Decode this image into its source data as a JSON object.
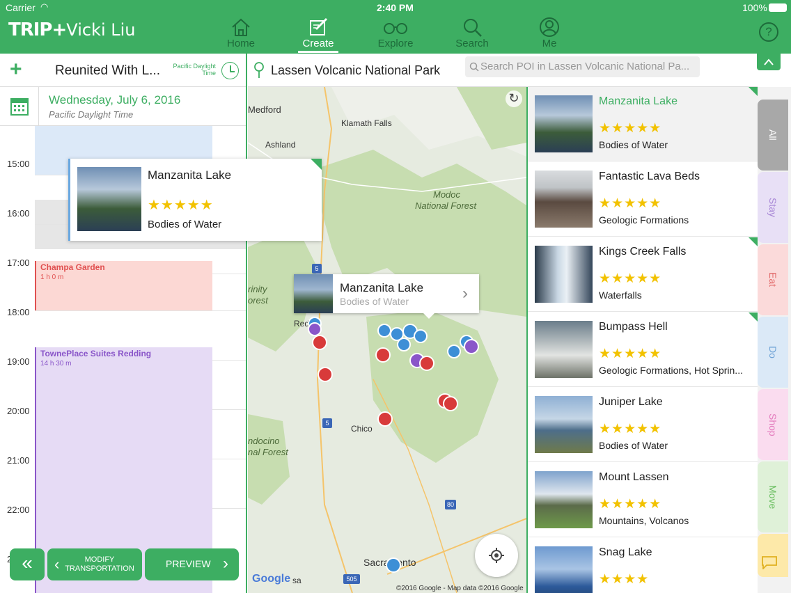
{
  "status": {
    "carrier": "Carrier",
    "time": "2:40 PM",
    "battery": "100%"
  },
  "app": {
    "logo": "TRIP",
    "plus": "+",
    "user": "Vicki Liu"
  },
  "nav": [
    {
      "label": "Home",
      "icon": "home-icon"
    },
    {
      "label": "Create",
      "icon": "create-icon"
    },
    {
      "label": "Explore",
      "icon": "binoculars-icon"
    },
    {
      "label": "Search",
      "icon": "search-icon"
    },
    {
      "label": "Me",
      "icon": "profile-icon"
    }
  ],
  "help_icon": "help-icon",
  "trip": {
    "title": "Reunited With L...",
    "tz_line1": "Pacific Daylight",
    "tz_line2": "Time"
  },
  "day": {
    "date": "Wednesday, July 6, 2016",
    "tz": "Pacific Daylight Time"
  },
  "hours": [
    "15:00",
    "16:00",
    "17:00",
    "18:00",
    "19:00",
    "20:00",
    "21:00",
    "22:00",
    "2"
  ],
  "events": [
    {
      "title": "Champa Garden",
      "duration": "1 h 0 m",
      "color": "#e05050"
    },
    {
      "title": "TownePlace Suites Redding",
      "duration": "14 h 30 m",
      "color": "#8a56c9"
    }
  ],
  "drag_card": {
    "name": "Manzanita Lake",
    "stars": "★★★★★",
    "category": "Bodies of Water"
  },
  "buttons": {
    "back": "«",
    "modify_line1": "MODIFY",
    "modify_line2": "TRANSPORTATION",
    "preview": "PREVIEW"
  },
  "park": {
    "name": "Lassen Volcanic National Park",
    "search_placeholder": "Search POI in Lassen Volcanic National Pa..."
  },
  "map": {
    "labels": [
      "Medford",
      "Klamath Falls",
      "Ashland",
      "Modoc",
      "National Forest",
      "rinity",
      "orest",
      "Red",
      "Chico",
      "ndocino",
      "nal Forest",
      "Sacramento",
      "sa"
    ],
    "shields": [
      "5",
      "5",
      "80",
      "505"
    ],
    "callout": {
      "name": "Manzanita Lake",
      "category": "Bodies of Water"
    },
    "logo": "Google",
    "attribution": "©2016 Google - Map data ©2016 Google"
  },
  "pois": [
    {
      "name": "Manzanita Lake",
      "rating": "★★★★★",
      "category": "Bodies of Water",
      "selected": true
    },
    {
      "name": "Fantastic Lava Beds",
      "rating": "★★★★★",
      "category": "Geologic Formations"
    },
    {
      "name": "Kings Creek Falls",
      "rating": "★★★★★",
      "category": "Waterfalls"
    },
    {
      "name": "Bumpass Hell",
      "rating": "★★★★★",
      "category": "Geologic Formations, Hot Sprin..."
    },
    {
      "name": "Juniper Lake",
      "rating": "★★★★★",
      "category": "Bodies of Water"
    },
    {
      "name": "Mount Lassen",
      "rating": "★★★★★",
      "category": "Mountains, Volcanos"
    },
    {
      "name": "Snag Lake",
      "rating": "★★★★",
      "category": ""
    }
  ],
  "tabs": [
    {
      "label": "All",
      "bg": "#a8a8a8",
      "fg": "#ffffff"
    },
    {
      "label": "Stay",
      "bg": "#e8e0f6",
      "fg": "#a887d6"
    },
    {
      "label": "Eat",
      "bg": "#fbdada",
      "fg": "#e26a6a"
    },
    {
      "label": "Do",
      "bg": "#dbe9f7",
      "fg": "#6ea2d6"
    },
    {
      "label": "Shop",
      "bg": "#fadcef",
      "fg": "#e37bbd"
    },
    {
      "label": "Move",
      "bg": "#dff1d8",
      "fg": "#6cbf62"
    },
    {
      "label": "",
      "bg": "#fde9a9",
      "fg": "#e0b020"
    }
  ]
}
